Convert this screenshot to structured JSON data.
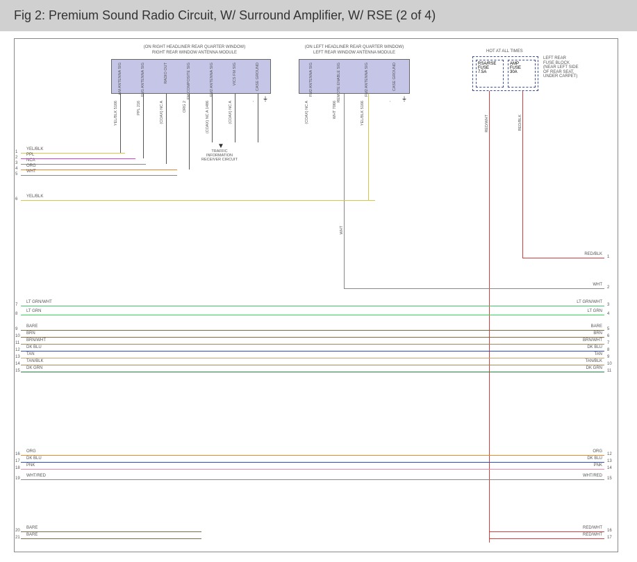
{
  "header": {
    "title": "Fig 2: Premium Sound Radio Circuit, W/ Surround Amplifier, W/ RSE (2 of 4)"
  },
  "modules": {
    "right": {
      "label_top": "(ON RIGHT HEADLINER REAR QUARTER WINDOW)",
      "label_sub": "RIGHT REAR WINDOW ANTENNA MODULE"
    },
    "left": {
      "label_top": "(ON LEFT HEADLINER REAR QUARTER WINDOW)",
      "label_sub": "LEFT REAR WINDOW ANTENNA MODULE"
    }
  },
  "right_pins": [
    "AM ANTENNA SIG",
    "FM1 ANTENNA SIG",
    "RADIO OUT",
    "FM COMPOSITE SIG",
    "FM2 ANTENNA SIG",
    "VICS FM SIG",
    "CASE GROUND"
  ],
  "left_pins": [
    "FM2 ANTENNA SIG",
    "REMOTE ENABLE SIG",
    "FM2 ANTENNA SIG",
    "CASE GROUND"
  ],
  "right_pin_colors": [
    "YEL/BLK 5166",
    "PPL 216",
    "(COAX) NC A",
    "ORG 2",
    "(COAX) NC A 1486",
    "(COAX) NC A",
    "-"
  ],
  "left_pin_colors": [
    "(COAX) NC A",
    "WHT 7066",
    "YEL/BLK 5166",
    "-"
  ],
  "fuse": {
    "hot": "HOT AT ALL TIMES",
    "cell1": {
      "l1": "RSA/RSE",
      "l2": "FUSE",
      "l3": "7.5A"
    },
    "cell2": {
      "l1": "AMP",
      "l2": "FUSE",
      "l3": "30A"
    },
    "desc": {
      "l1": "LEFT REAR",
      "l2": "FUSE BLOCK",
      "l3": "(NEAR LEFT SIDE",
      "l4": "OF REAR SEAT,",
      "l5": "UNDER CARPET)"
    }
  },
  "traffic": {
    "l1": "TRAFFIC",
    "l2": "INFORMATION",
    "l3": "RECEIVER CIRCUIT"
  },
  "left_wires": [
    {
      "num": "1",
      "label": "YEL/BLK",
      "color": "#d4c74a"
    },
    {
      "num": "2",
      "label": "PPL",
      "color": "#d63cd6"
    },
    {
      "num": "3",
      "label": "NCA",
      "color": "#888"
    },
    {
      "num": "4",
      "label": "ORG",
      "color": "#e88a2a"
    },
    {
      "num": "5",
      "label": "WHT",
      "color": "#888"
    },
    {
      "num": "6",
      "label": "YEL/BLK",
      "color": "#d4c74a"
    },
    {
      "num": "7",
      "label": "LT GRN/WHT",
      "color": "#3ac76a"
    },
    {
      "num": "8",
      "label": "LT GRN",
      "color": "#2ee052"
    },
    {
      "num": "9",
      "label": "BARE",
      "color": "#7a6a4a"
    },
    {
      "num": "10",
      "label": "BRN",
      "color": "#8a6a3a"
    },
    {
      "num": "11",
      "label": "BRN/WHT",
      "color": "#a08560"
    },
    {
      "num": "12",
      "label": "DK BLU",
      "color": "#2a4ac7"
    },
    {
      "num": "13",
      "label": "TAN",
      "color": "#c7a76a"
    },
    {
      "num": "14",
      "label": "TAN/BLK",
      "color": "#a78a5a"
    },
    {
      "num": "15",
      "label": "DK GRN",
      "color": "#188a3a"
    },
    {
      "num": "16",
      "label": "ORG",
      "color": "#e88a2a"
    },
    {
      "num": "17",
      "label": "DK BLU",
      "color": "#2a4ac7"
    },
    {
      "num": "18",
      "label": "PNK",
      "color": "#e88aaa"
    },
    {
      "num": "19",
      "label": "WHT/RED",
      "color": "#888"
    },
    {
      "num": "20",
      "label": "BARE",
      "color": "#7a6a4a"
    },
    {
      "num": "21",
      "label": "BARE",
      "color": "#7a6a4a"
    }
  ],
  "right_wires": [
    {
      "num": "1",
      "label": "RED/BLK",
      "color": "#d63c3c"
    },
    {
      "num": "2",
      "label": "WHT",
      "color": "#888"
    },
    {
      "num": "3",
      "label": "LT GRN/WHT",
      "color": "#3ac76a"
    },
    {
      "num": "4",
      "label": "LT GRN",
      "color": "#2ee052"
    },
    {
      "num": "5",
      "label": "BARE",
      "color": "#7a6a4a"
    },
    {
      "num": "6",
      "label": "BRN",
      "color": "#8a6a3a"
    },
    {
      "num": "7",
      "label": "BRN/WHT",
      "color": "#a08560"
    },
    {
      "num": "8",
      "label": "DK BLU",
      "color": "#2a4ac7"
    },
    {
      "num": "9",
      "label": "TAN",
      "color": "#c7a76a"
    },
    {
      "num": "10",
      "label": "TAN/BLK",
      "color": "#a78a5a"
    },
    {
      "num": "11",
      "label": "DK GRN",
      "color": "#188a3a"
    },
    {
      "num": "12",
      "label": "ORG",
      "color": "#e88a2a"
    },
    {
      "num": "13",
      "label": "DK BLU",
      "color": "#2a4ac7"
    },
    {
      "num": "14",
      "label": "PNK",
      "color": "#e88aaa"
    },
    {
      "num": "15",
      "label": "WHT/RED",
      "color": "#888"
    },
    {
      "num": "16",
      "label": "RED/WHT",
      "color": "#d63c3c"
    },
    {
      "num": "17",
      "label": "RED/WHT",
      "color": "#d63c3c"
    }
  ],
  "vwire_labels": {
    "redwht": "RED/WHT",
    "redblk": "RED/BLK",
    "wht": "WHT"
  },
  "chart_data": {
    "type": "wiring-diagram",
    "title": "Premium Sound Radio Circuit, W/ Surround Amplifier, W/ RSE (2 of 4)",
    "modules": [
      {
        "name": "RIGHT REAR WINDOW ANTENNA MODULE",
        "location": "ON RIGHT HEADLINER REAR QUARTER WINDOW",
        "pins": [
          "AM ANTENNA SIG",
          "FM1 ANTENNA SIG",
          "RADIO OUT",
          "FM COMPOSITE SIG",
          "FM2 ANTENNA SIG",
          "VICS FM SIG",
          "CASE GROUND"
        ]
      },
      {
        "name": "LEFT REAR WINDOW ANTENNA MODULE",
        "location": "ON LEFT HEADLINER REAR QUARTER WINDOW",
        "pins": [
          "FM2 ANTENNA SIG",
          "REMOTE ENABLE SIG",
          "FM2 ANTENNA SIG",
          "CASE GROUND"
        ]
      },
      {
        "name": "LEFT REAR FUSE BLOCK",
        "location": "NEAR LEFT SIDE OF REAR SEAT, UNDER CARPET",
        "fuses": [
          {
            "name": "RSA/RSE FUSE",
            "rating": "7.5A"
          },
          {
            "name": "AMP FUSE",
            "rating": "30A"
          }
        ],
        "supply": "HOT AT ALL TIMES"
      }
    ],
    "left_connector_wires": [
      {
        "pin": 1,
        "color": "YEL/BLK"
      },
      {
        "pin": 2,
        "color": "PPL"
      },
      {
        "pin": 3,
        "color": "NCA"
      },
      {
        "pin": 4,
        "color": "ORG"
      },
      {
        "pin": 5,
        "color": "WHT"
      },
      {
        "pin": 6,
        "color": "YEL/BLK"
      },
      {
        "pin": 7,
        "color": "LT GRN/WHT"
      },
      {
        "pin": 8,
        "color": "LT GRN"
      },
      {
        "pin": 9,
        "color": "BARE"
      },
      {
        "pin": 10,
        "color": "BRN"
      },
      {
        "pin": 11,
        "color": "BRN/WHT"
      },
      {
        "pin": 12,
        "color": "DK BLU"
      },
      {
        "pin": 13,
        "color": "TAN"
      },
      {
        "pin": 14,
        "color": "TAN/BLK"
      },
      {
        "pin": 15,
        "color": "DK GRN"
      },
      {
        "pin": 16,
        "color": "ORG"
      },
      {
        "pin": 17,
        "color": "DK BLU"
      },
      {
        "pin": 18,
        "color": "PNK"
      },
      {
        "pin": 19,
        "color": "WHT/RED"
      },
      {
        "pin": 20,
        "color": "BARE"
      },
      {
        "pin": 21,
        "color": "BARE"
      }
    ],
    "right_connector_wires": [
      {
        "pin": 1,
        "color": "RED/BLK"
      },
      {
        "pin": 2,
        "color": "WHT"
      },
      {
        "pin": 3,
        "color": "LT GRN/WHT"
      },
      {
        "pin": 4,
        "color": "LT GRN"
      },
      {
        "pin": 5,
        "color": "BARE"
      },
      {
        "pin": 6,
        "color": "BRN"
      },
      {
        "pin": 7,
        "color": "BRN/WHT"
      },
      {
        "pin": 8,
        "color": "DK BLU"
      },
      {
        "pin": 9,
        "color": "TAN"
      },
      {
        "pin": 10,
        "color": "TAN/BLK"
      },
      {
        "pin": 11,
        "color": "DK GRN"
      },
      {
        "pin": 12,
        "color": "ORG"
      },
      {
        "pin": 13,
        "color": "DK BLU"
      },
      {
        "pin": 14,
        "color": "PNK"
      },
      {
        "pin": 15,
        "color": "WHT/RED"
      },
      {
        "pin": 16,
        "color": "RED/WHT"
      },
      {
        "pin": 17,
        "color": "RED/WHT"
      }
    ],
    "branches": [
      {
        "from": "RIGHT REAR WINDOW ANTENNA MODULE / VICS FM SIG",
        "to": "TRAFFIC INFORMATION RECEIVER CIRCUIT"
      },
      {
        "from": "LEFT REAR FUSE BLOCK / RSA/RSE FUSE",
        "wire": "RED/WHT"
      },
      {
        "from": "LEFT REAR FUSE BLOCK / AMP FUSE",
        "wire": "RED/BLK"
      }
    ]
  }
}
